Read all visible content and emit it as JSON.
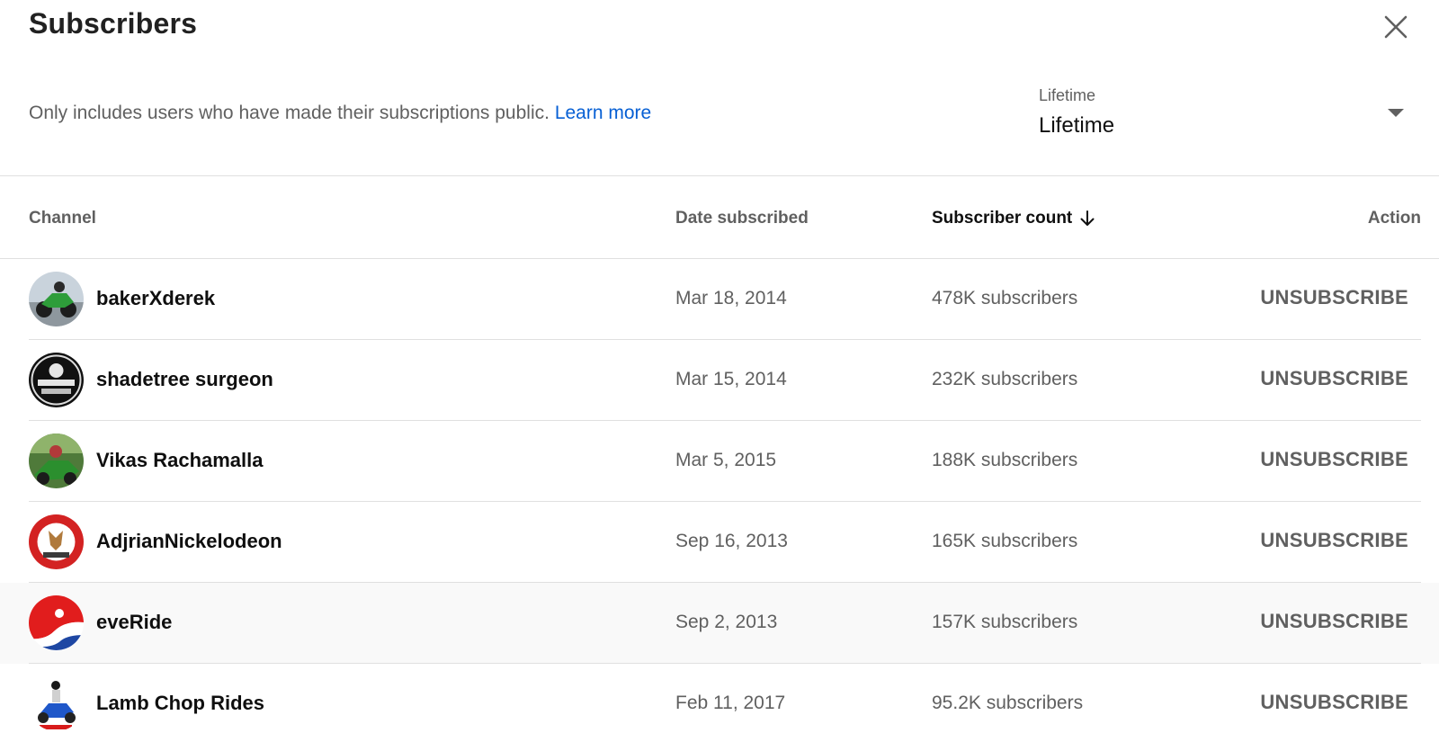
{
  "dialog": {
    "title": "Subscribers",
    "close_icon": "close-icon"
  },
  "notice": {
    "text": "Only includes users who have made their subscriptions public.",
    "link_label": "Learn more"
  },
  "filter": {
    "label": "Lifetime",
    "value": "Lifetime",
    "icon": "caret-down-icon"
  },
  "table": {
    "columns": {
      "channel": "Channel",
      "date": "Date subscribed",
      "count": "Subscriber count",
      "action": "Action"
    },
    "sort_icon": "arrow-down-icon",
    "rows": [
      {
        "name": "bakerXderek",
        "date": "Mar 18, 2014",
        "count": "478K subscribers",
        "action": "UNSUBSCRIBE"
      },
      {
        "name": "shadetree surgeon",
        "date": "Mar 15, 2014",
        "count": "232K subscribers",
        "action": "UNSUBSCRIBE"
      },
      {
        "name": "Vikas Rachamalla",
        "date": "Mar 5, 2015",
        "count": "188K subscribers",
        "action": "UNSUBSCRIBE"
      },
      {
        "name": "AdjrianNickelodeon",
        "date": "Sep 16, 2013",
        "count": "165K subscribers",
        "action": "UNSUBSCRIBE"
      },
      {
        "name": "eveRide",
        "date": "Sep 2, 2013",
        "count": "157K subscribers",
        "action": "UNSUBSCRIBE"
      },
      {
        "name": "Lamb Chop Rides",
        "date": "Feb 11, 2017",
        "count": "95.2K subscribers",
        "action": "UNSUBSCRIBE"
      }
    ]
  },
  "colors": {
    "link": "#065fd4",
    "secondary_text": "#606060",
    "divider": "#e0e0e0",
    "hover_row": "#f9f9f9"
  }
}
